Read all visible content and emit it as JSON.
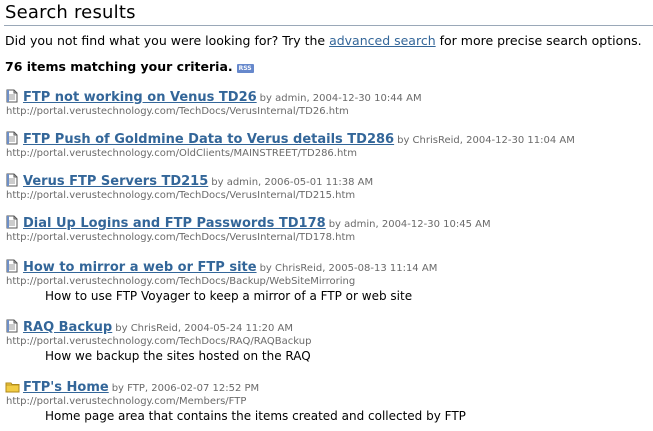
{
  "header": {
    "title": "Search results"
  },
  "intro": {
    "before": "Did you not find what you were looking for? Try the ",
    "link": "advanced search",
    "after": " for more precise search options."
  },
  "summary": {
    "count_text": "76 items matching your criteria.",
    "rss_badge": "RSS"
  },
  "results": [
    {
      "title": "FTP not working on Venus TD26",
      "meta": "by admin, 2004-12-30 10:44 AM",
      "url": "http://portal.verustechnology.com/TechDocs/VerusInternal/TD26.htm",
      "description": "",
      "icon": "document-icon"
    },
    {
      "title": "FTP Push of Goldmine Data to Verus details TD286",
      "meta": "by ChrisReid, 2004-12-30 11:04 AM",
      "url": "http://portal.verustechnology.com/OldClients/MAINSTREET/TD286.htm",
      "description": "",
      "icon": "document-icon"
    },
    {
      "title": "Verus FTP Servers TD215",
      "meta": "by admin, 2006-05-01 11:38 AM",
      "url": "http://portal.verustechnology.com/TechDocs/VerusInternal/TD215.htm",
      "description": "",
      "icon": "document-icon"
    },
    {
      "title": "Dial Up Logins and FTP Passwords TD178",
      "meta": "by admin, 2004-12-30 10:45 AM",
      "url": "http://portal.verustechnology.com/TechDocs/VerusInternal/TD178.htm",
      "description": "",
      "icon": "document-icon"
    },
    {
      "title": "How to mirror a web or FTP site",
      "meta": "by ChrisReid, 2005-08-13 11:14 AM",
      "url": "http://portal.verustechnology.com/TechDocs/Backup/WebSiteMirroring",
      "description": "How to use FTP Voyager to keep a mirror of a FTP or web site",
      "icon": "document-icon"
    },
    {
      "title": "RAQ Backup",
      "meta": "by ChrisReid, 2004-05-24 11:20 AM",
      "url": "http://portal.verustechnology.com/TechDocs/RAQ/RAQBackup",
      "description": "How we backup the sites hosted on the RAQ",
      "icon": "document-icon"
    },
    {
      "title": "FTP's Home",
      "meta": "by FTP, 2006-02-07 12:52 PM",
      "url": "http://portal.verustechnology.com/Members/FTP",
      "description": "Home page area that contains the items created and collected by FTP",
      "icon": "folder-icon"
    }
  ],
  "colors": {
    "link": "#336699",
    "meta": "#6a6a6a",
    "rule": "#9aa8b8",
    "rss": "#6688cc",
    "folder": "#f2cc44"
  }
}
